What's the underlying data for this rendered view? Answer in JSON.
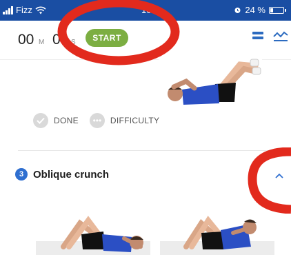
{
  "status_bar": {
    "carrier": "Fizz",
    "time": "10:5",
    "battery": "24 %",
    "battery_level": 0.24
  },
  "timer": {
    "minutes": "00",
    "minutes_unit": "M",
    "seconds": "0",
    "seconds_unit": "S",
    "start_label": "START"
  },
  "exercise_status": {
    "done_label": "DONE",
    "difficulty_label": "DIFFICULTY"
  },
  "next_exercise": {
    "number": "3",
    "title": "Oblique crunch"
  },
  "colors": {
    "status_bar": "#1a4ea3",
    "start_button": "#7cae42",
    "accent": "#2f6fd0",
    "annotation": "#e22a1d"
  },
  "icons": [
    "wifi-icon",
    "alarm-icon",
    "battery-icon",
    "list-icon",
    "chart-icon",
    "check-icon",
    "chevron-up-icon"
  ]
}
